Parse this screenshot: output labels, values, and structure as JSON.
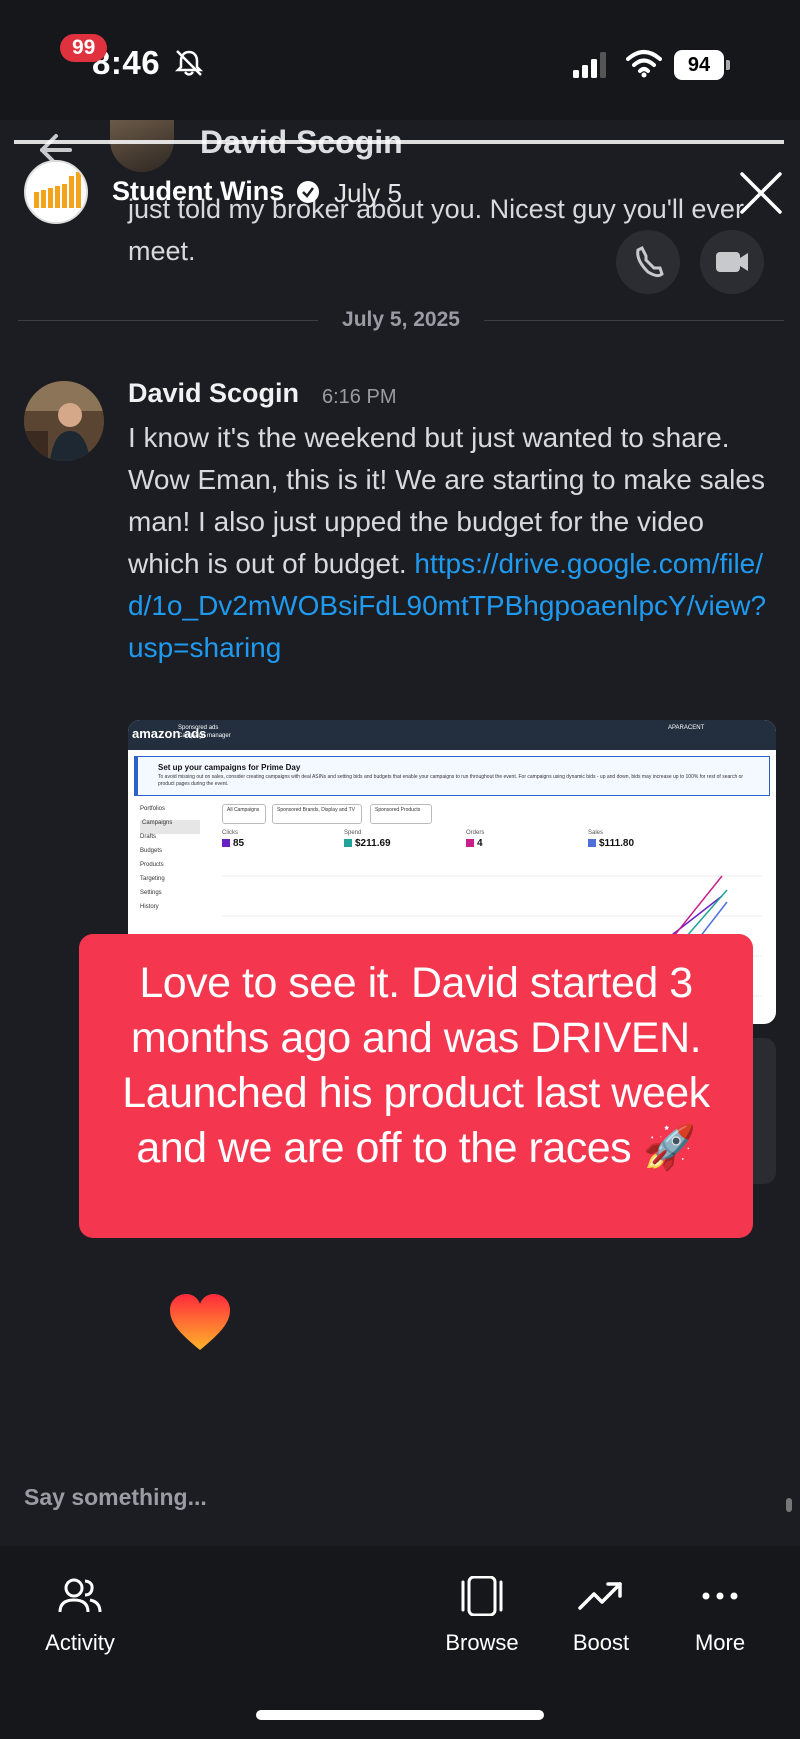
{
  "status_bar": {
    "time": "8:46",
    "battery": "94"
  },
  "chat_header": {
    "contact_name": "David Scogin",
    "unread_badge": "99"
  },
  "story": {
    "account_name": "Student Wins",
    "date": "July 5",
    "caption": "Love to see it. David started 3 months ago and was DRIVEN. Launched his product last week and we are off to the races 🚀"
  },
  "previous_message": {
    "text": "just told my broker about you. Nicest guy you'll ever meet."
  },
  "date_divider": "July 5, 2025",
  "message": {
    "author": "David Scogin",
    "time": "6:16 PM",
    "text": "I know it's the weekend but just wanted to share. Wow Eman, this is it! We are starting to make sales man! I also just upped the budget for the video which is out of budget. ",
    "link": "https://drive.google.com/file/d/1o_Dv2mWOBsiFdL90mtTPBhgpoaenlpcY/view?usp=sharing"
  },
  "attachment": {
    "logo": "amazon ads",
    "sub_title": "Sponsored ads",
    "sub_title_2": "Campaign manager",
    "account": "APARACENT",
    "banner_title": "Set up your campaigns for Prime Day",
    "banner_text": "To avoid missing out on sales, consider creating campaigns with deal ASINs and setting bids and budgets that enable your campaigns to run throughout the event. For campaigns using dynamic bids - up and down, bids may increase up to 100% for rest of search or product pages during the event.",
    "sidebar": [
      "Portfolios",
      "Campaigns",
      "Drafts",
      "Budgets",
      "Products",
      "Targeting",
      "Settings",
      "History"
    ],
    "tabs": [
      "All Campaigns",
      "Sponsored Brands, Display and TV",
      "Sponsored Products"
    ],
    "metrics": [
      {
        "label": "Clicks",
        "value": "85",
        "color": "#6a1fc4"
      },
      {
        "label": "Spend",
        "value": "$211.69",
        "color": "#1fa39a"
      },
      {
        "label": "Orders",
        "value": "4",
        "color": "#c81e8c"
      },
      {
        "label": "Sales",
        "value": "$111.80",
        "color": "#4f6fd9"
      }
    ]
  },
  "input": {
    "placeholder": "Say something..."
  },
  "bottom_nav": {
    "activity": "Activity",
    "browse": "Browse",
    "boost": "Boost",
    "more": "More"
  },
  "colors": {
    "story_card": "#f5364f",
    "link": "#1e9bf0",
    "background": "#1c1d22"
  }
}
